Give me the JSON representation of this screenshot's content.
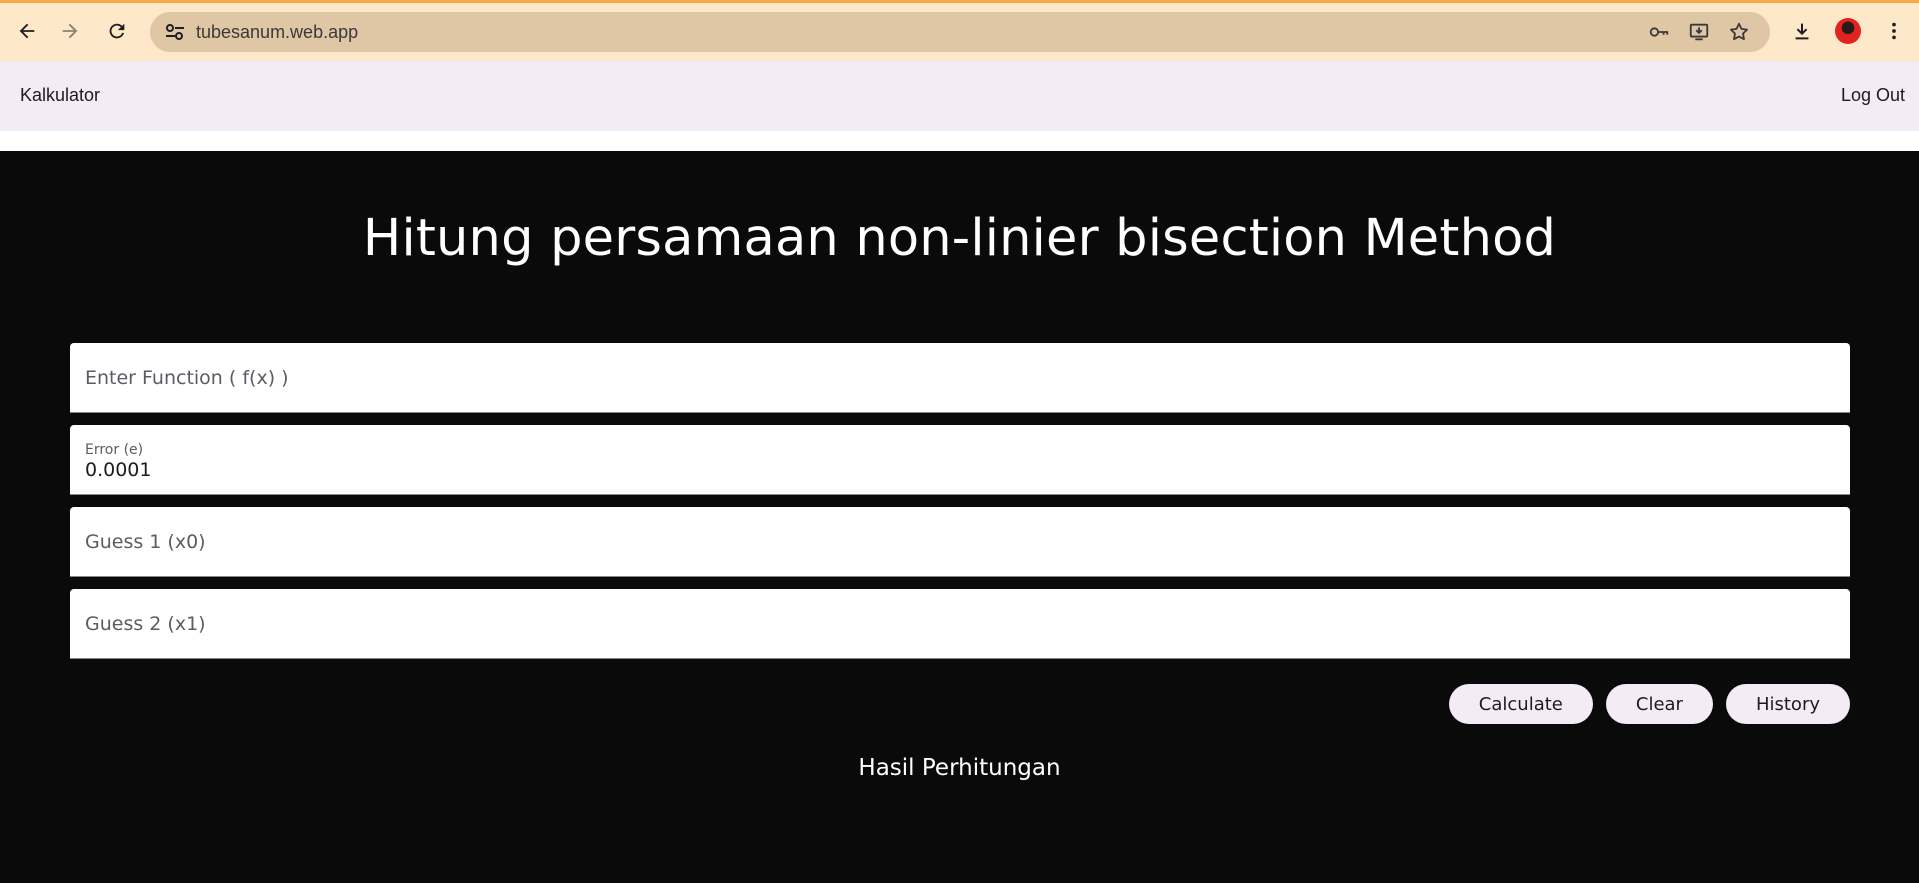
{
  "browser": {
    "url": "tubesanum.web.app",
    "icons": [
      "back-icon",
      "forward-icon",
      "reload-icon",
      "site-settings-icon",
      "password-key-icon",
      "install-app-icon",
      "bookmark-star-icon",
      "download-icon",
      "profile-avatar",
      "more-menu-icon"
    ]
  },
  "appbar": {
    "title": "Kalkulator",
    "logout_label": "Log Out"
  },
  "main": {
    "title": "Hitung persamaan non-linier bisection Method",
    "fields": {
      "function_placeholder": "Enter Function ( f(x) )",
      "error_label": "Error (e)",
      "error_value": "0.0001",
      "guess1_placeholder": "Guess 1 (x0)",
      "guess2_placeholder": "Guess 2 (x1)"
    },
    "buttons": {
      "calculate": "Calculate",
      "clear": "Clear",
      "history": "History"
    },
    "result_title": "Hasil Perhitungan"
  },
  "colors": {
    "background": "#0a0a0a",
    "appbar": "#f3ecf6",
    "chrome": "#fde8c9",
    "omnibox": "#dfc6a4"
  }
}
